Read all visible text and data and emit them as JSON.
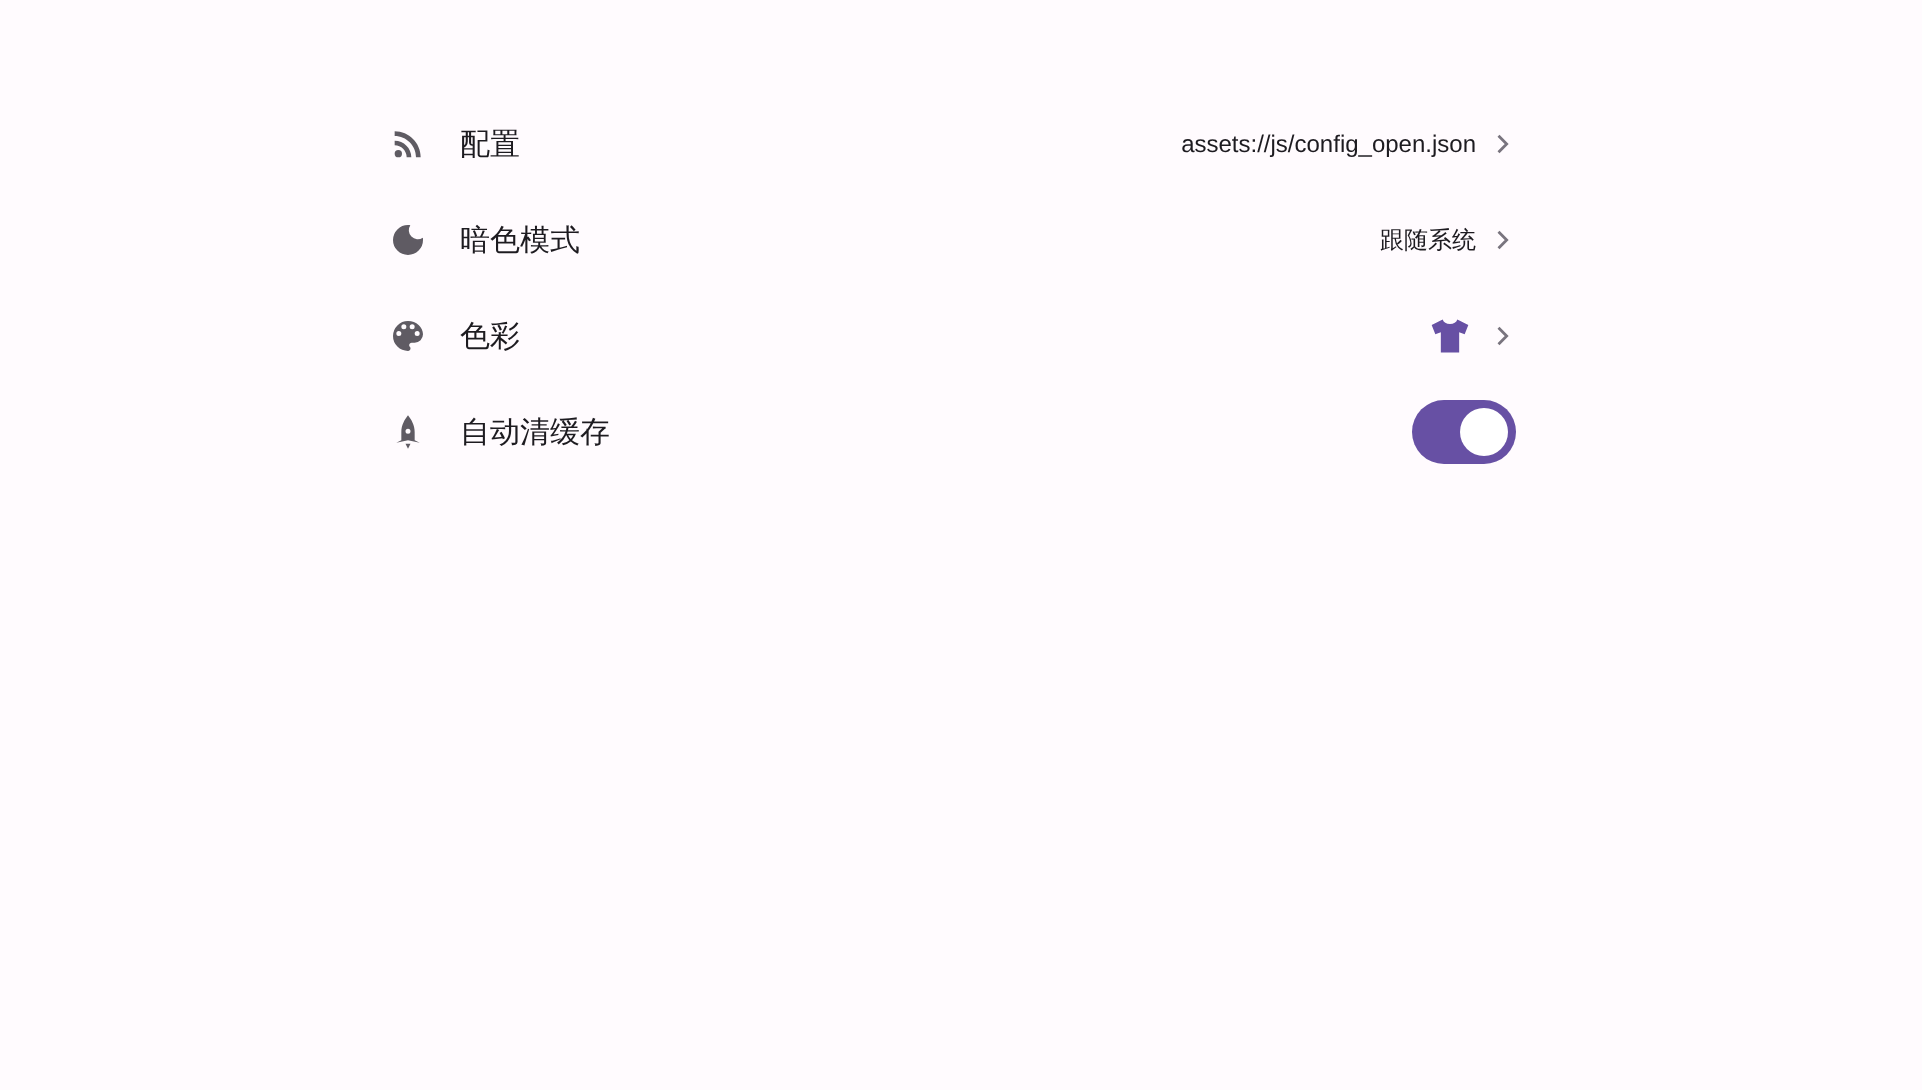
{
  "settings": [
    {
      "kind": "link",
      "label": "配置",
      "value": "assets://js/config_open.json"
    },
    {
      "kind": "link",
      "label": "暗色模式",
      "value": "跟随系统"
    },
    {
      "kind": "color",
      "label": "色彩",
      "color": "#6750a4"
    },
    {
      "kind": "switch",
      "label": "自动清缓存",
      "on": true
    }
  ]
}
